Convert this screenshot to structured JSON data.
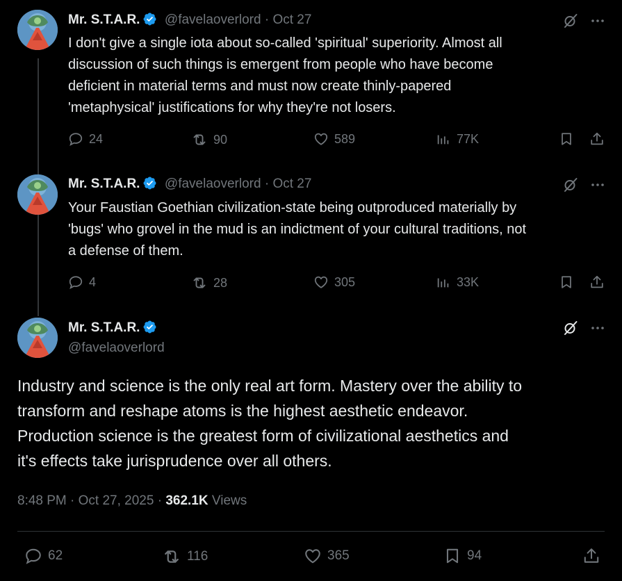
{
  "tweets": [
    {
      "name": "Mr. S.T.A.R.",
      "handle_meta": "@favelaoverlord · Oct 27",
      "text": [
        "I don't give a single iota about so-called  'spiritual' superiority. Almost all",
        "discussion of such things is emergent from people who have become",
        "deficient in material terms and must now create thinly-papered",
        "'metaphysical' justifications for why they're not losers."
      ],
      "replies": "24",
      "reposts": "90",
      "likes": "589",
      "views": "77K"
    },
    {
      "name": "Mr. S.T.A.R.",
      "handle_meta": "@favelaoverlord · Oct 27",
      "text": [
        "Your Faustian Goethian civilization-state being outproduced materially by",
        "'bugs' who grovel in the mud is an indictment of your cultural traditions, not",
        "a defense of them."
      ],
      "replies": "4",
      "reposts": "28",
      "likes": "305",
      "views": "33K"
    }
  ],
  "main": {
    "name": "Mr. S.T.A.R.",
    "handle": "@favelaoverlord",
    "text": [
      "Industry and science is the only real art form. Mastery over the ability to",
      "transform and reshape atoms is the highest aesthetic endeavor.",
      "Production science is the greatest form of civilizational aesthetics and",
      "it's effects take jurisprudence over all others."
    ],
    "time": "8:48 PM · Oct 27, 2025 · ",
    "views_count": "362.1K",
    "views_label": " Views",
    "replies": "62",
    "reposts": "116",
    "likes": "365",
    "bookmarks": "94"
  },
  "colors": {
    "verified": "#1d9bf0",
    "muted": "#71767b",
    "text": "#e7e9ea",
    "background": "#000000"
  }
}
